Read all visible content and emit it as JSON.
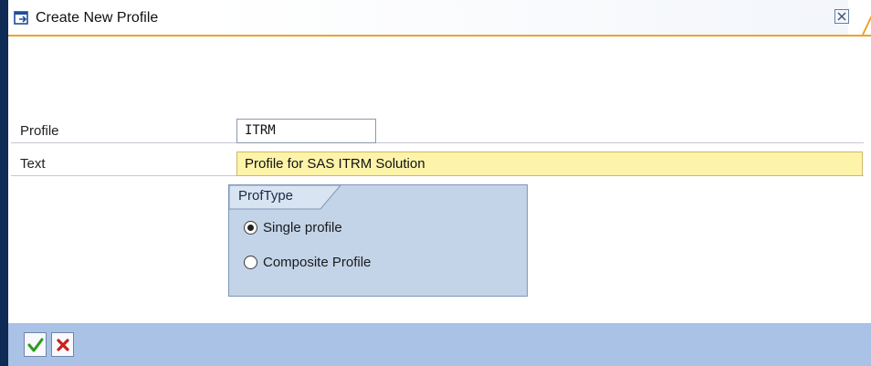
{
  "window": {
    "title": "Create New Profile",
    "accent_color": "#e9a42a",
    "border_color": "#0f2a55"
  },
  "form": {
    "profile_label": "Profile",
    "profile_value": "ITRM",
    "text_label": "Text",
    "text_value": "Profile for SAS ITRM Solution"
  },
  "prof_type": {
    "title": "ProfType",
    "options": [
      {
        "label": "Single profile",
        "selected": true
      },
      {
        "label": "Composite Profile",
        "selected": false
      }
    ]
  },
  "footer": {
    "buttons": [
      {
        "icon": "checkmark-icon",
        "color": "#2e9a1c"
      },
      {
        "icon": "cross-icon",
        "color": "#c8201e"
      }
    ]
  }
}
